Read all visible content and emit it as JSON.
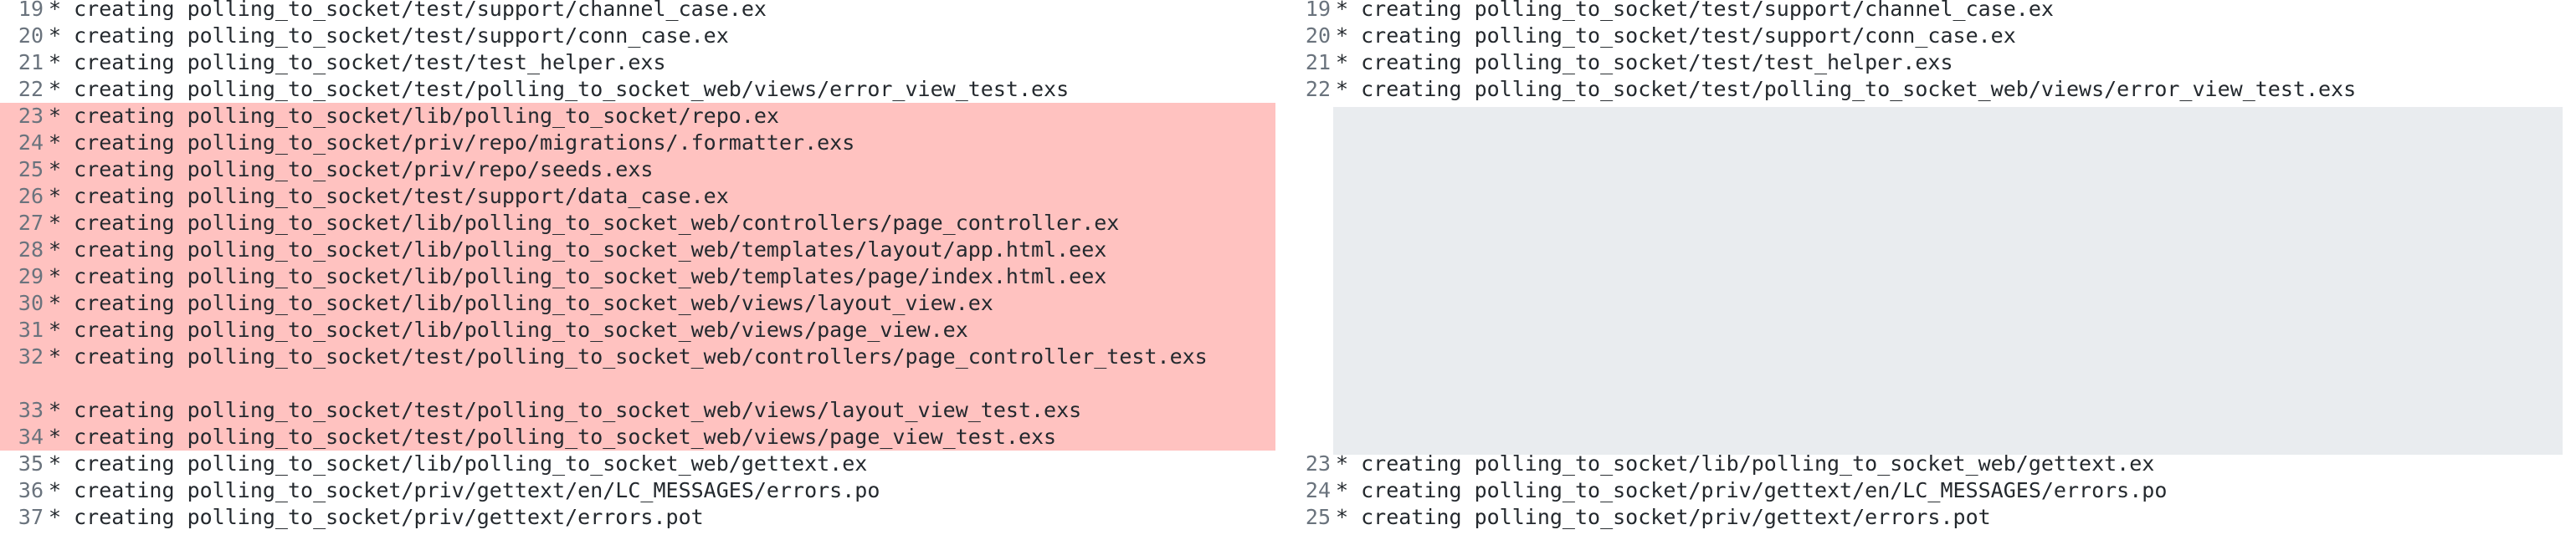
{
  "left": {
    "lines": [
      {
        "num": "19",
        "text": "* creating polling_to_socket/test/support/channel_case.ex"
      },
      {
        "num": "20",
        "text": "* creating polling_to_socket/test/support/conn_case.ex"
      },
      {
        "num": "21",
        "text": "* creating polling_to_socket/test/test_helper.exs"
      },
      {
        "num": "22",
        "text": "* creating polling_to_socket/test/polling_to_socket_web/views/error_view_test.exs"
      },
      {
        "num": "23",
        "text": "* creating polling_to_socket/lib/polling_to_socket/repo.ex"
      },
      {
        "num": "24",
        "text": "* creating polling_to_socket/priv/repo/migrations/.formatter.exs"
      },
      {
        "num": "25",
        "text": "* creating polling_to_socket/priv/repo/seeds.exs"
      },
      {
        "num": "26",
        "text": "* creating polling_to_socket/test/support/data_case.ex"
      },
      {
        "num": "27",
        "text": "* creating polling_to_socket/lib/polling_to_socket_web/controllers/page_controller.ex"
      },
      {
        "num": "28",
        "text": "* creating polling_to_socket/lib/polling_to_socket_web/templates/layout/app.html.eex"
      },
      {
        "num": "29",
        "text": "* creating polling_to_socket/lib/polling_to_socket_web/templates/page/index.html.eex"
      },
      {
        "num": "30",
        "text": "* creating polling_to_socket/lib/polling_to_socket_web/views/layout_view.ex"
      },
      {
        "num": "31",
        "text": "* creating polling_to_socket/lib/polling_to_socket_web/views/page_view.ex"
      },
      {
        "num": "32",
        "text": "* creating polling_to_socket/test/polling_to_socket_web/controllers/page_controller_test.exs"
      },
      {
        "num": "33",
        "text": "* creating polling_to_socket/test/polling_to_socket_web/views/layout_view_test.exs"
      },
      {
        "num": "34",
        "text": "* creating polling_to_socket/test/polling_to_socket_web/views/page_view_test.exs"
      },
      {
        "num": "35",
        "text": "* creating polling_to_socket/lib/polling_to_socket_web/gettext.ex"
      },
      {
        "num": "36",
        "text": "* creating polling_to_socket/priv/gettext/en/LC_MESSAGES/errors.po"
      },
      {
        "num": "37",
        "text": "* creating polling_to_socket/priv/gettext/errors.pot"
      }
    ]
  },
  "right": {
    "lines": [
      {
        "num": "19",
        "text": "* creating polling_to_socket/test/support/channel_case.ex"
      },
      {
        "num": "20",
        "text": "* creating polling_to_socket/test/support/conn_case.ex"
      },
      {
        "num": "21",
        "text": "* creating polling_to_socket/test/test_helper.exs"
      },
      {
        "num": "22",
        "text": "* creating polling_to_socket/test/polling_to_socket_web/views/error_view_test.exs"
      },
      {
        "num": "23",
        "text": "* creating polling_to_socket/lib/polling_to_socket_web/gettext.ex"
      },
      {
        "num": "24",
        "text": "* creating polling_to_socket/priv/gettext/en/LC_MESSAGES/errors.po"
      },
      {
        "num": "25",
        "text": "* creating polling_to_socket/priv/gettext/errors.pot"
      }
    ]
  },
  "colors": {
    "removed_bg": "#ffc2c0",
    "placeholder_bg": "#e9ecef",
    "line_number": "#6a737d",
    "text": "#24292e"
  }
}
